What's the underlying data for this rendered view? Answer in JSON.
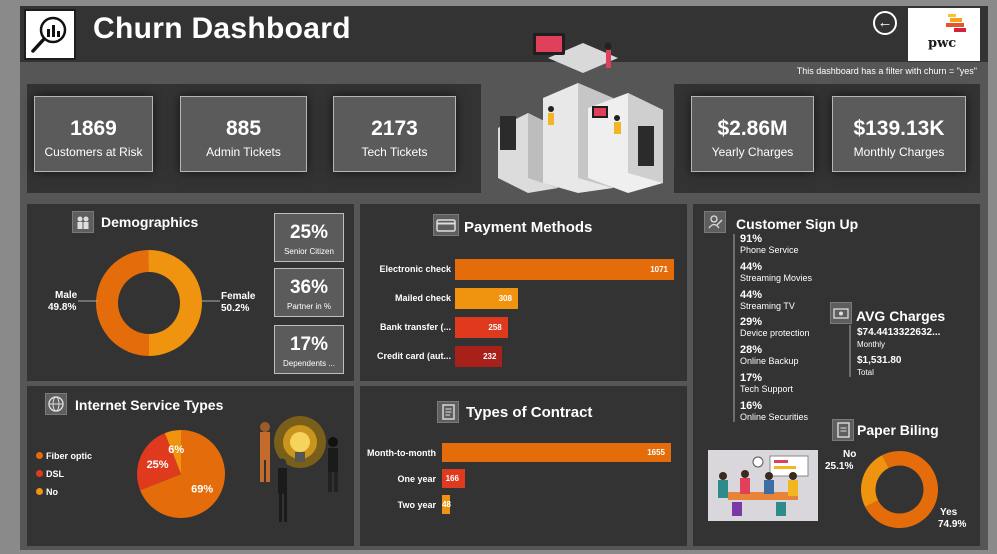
{
  "header": {
    "title": "Churn Dashboard",
    "filter_note": "This dashboard has a filter with churn = \"yes\"",
    "brand": "pwc"
  },
  "kpis": [
    {
      "value": "1869",
      "label": "Customers at Risk"
    },
    {
      "value": "885",
      "label": "Admin Tickets"
    },
    {
      "value": "2173",
      "label": "Tech Tickets"
    },
    {
      "value": "$2.86M",
      "label": "Yearly Charges"
    },
    {
      "value": "$139.13K",
      "label": "Monthly Charges"
    }
  ],
  "demographics": {
    "title": "Demographics",
    "male_label": "Male",
    "male_pct": "49.8%",
    "female_label": "Female",
    "female_pct": "50.2%",
    "stats": [
      {
        "value": "25%",
        "label": "Senior Citizen"
      },
      {
        "value": "36%",
        "label": "Partner in %"
      },
      {
        "value": "17%",
        "label": "Dependents ..."
      }
    ]
  },
  "internet": {
    "title": "Internet Service Types",
    "legend": [
      "Fiber optic",
      "DSL",
      "No"
    ]
  },
  "payment": {
    "title": "Payment Methods",
    "labels": [
      "Electronic check",
      "Mailed check",
      "Bank transfer (...",
      "Credit card (aut..."
    ],
    "values": [
      "1071",
      "308",
      "258",
      "232"
    ]
  },
  "contract": {
    "title": "Types of Contract",
    "labels": [
      "Month-to-month",
      "One year",
      "Two year"
    ],
    "values": [
      "1655",
      "166",
      "48"
    ]
  },
  "signup": {
    "title": "Customer Sign Up",
    "items": [
      {
        "pct": "91%",
        "name": "Phone Service"
      },
      {
        "pct": "44%",
        "name": "Streaming Movies"
      },
      {
        "pct": "44%",
        "name": "Streaming TV"
      },
      {
        "pct": "29%",
        "name": "Device protection"
      },
      {
        "pct": "28%",
        "name": "Online Backup"
      },
      {
        "pct": "17%",
        "name": "Tech Support"
      },
      {
        "pct": "16%",
        "name": "Online Securities"
      }
    ]
  },
  "avg": {
    "title": "AVG Charges",
    "monthly_value": "$74.4413322632...",
    "monthly_label": "Monthly",
    "total_value": "$1,531.80",
    "total_label": "Total"
  },
  "paper": {
    "title": "Paper Biling",
    "no_label": "No",
    "no_pct": "25.1%",
    "yes_label": "Yes",
    "yes_pct": "74.9%"
  },
  "chart_data": [
    {
      "type": "pie",
      "categories": [
        "Male",
        "Female"
      ],
      "values": [
        49.8,
        50.2
      ]
    },
    {
      "type": "pie",
      "categories": [
        "Fiber optic",
        "DSL",
        "No"
      ],
      "values": [
        69,
        25,
        6
      ],
      "labels": [
        "69%",
        "25%",
        "6%"
      ]
    },
    {
      "type": "bar",
      "title": "Payment Methods",
      "categories": [
        "Electronic check",
        "Mailed check",
        "Bank transfer (...",
        "Credit card (aut..."
      ],
      "values": [
        1071,
        308,
        258,
        232
      ]
    },
    {
      "type": "bar",
      "title": "Types of Contract",
      "categories": [
        "Month-to-month",
        "One year",
        "Two year"
      ],
      "values": [
        1655,
        166,
        48
      ]
    },
    {
      "type": "pie",
      "title": "Paper Biling",
      "categories": [
        "No",
        "Yes"
      ],
      "values": [
        25.1,
        74.9
      ]
    }
  ],
  "colors": {
    "orange": "#e46c0a",
    "amber": "#f0940f",
    "red": "#e03a1e",
    "dark_red": "#a8201a",
    "panel": "#333333",
    "kpi": "#5b5b5b"
  }
}
